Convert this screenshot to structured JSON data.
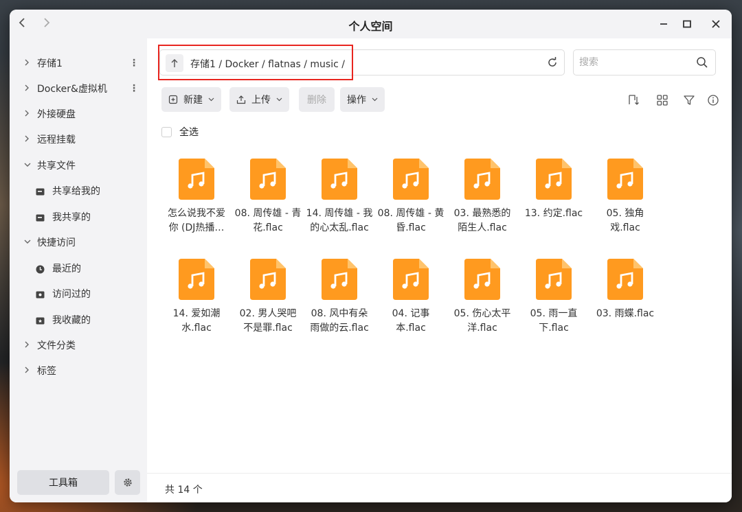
{
  "window": {
    "title": "个人空间",
    "back_glyph": "‹",
    "forward_glyph": "›"
  },
  "sidebar": {
    "items": [
      {
        "label": "存储1",
        "expandable": true,
        "has_more": true
      },
      {
        "label": "Docker&虚拟机",
        "expandable": true,
        "has_more": true
      },
      {
        "label": "外接硬盘",
        "expandable": true
      },
      {
        "label": "远程挂载",
        "expandable": true
      },
      {
        "label": "共享文件",
        "expanded": true
      },
      {
        "label": "共享给我的",
        "icon": "share-in-icon"
      },
      {
        "label": "我共享的",
        "icon": "share-out-icon"
      },
      {
        "label": "快捷访问",
        "expanded": true
      },
      {
        "label": "最近的",
        "icon": "clock-icon"
      },
      {
        "label": "访问过的",
        "icon": "visited-icon"
      },
      {
        "label": "我收藏的",
        "icon": "favorite-icon"
      },
      {
        "label": "文件分类",
        "expandable": true
      },
      {
        "label": "标签",
        "expandable": true
      }
    ],
    "toolbox_label": "工具箱"
  },
  "path": {
    "text": "存储1 / Docker / flatnas / music /"
  },
  "search": {
    "placeholder": "搜索"
  },
  "toolbar": {
    "new_label": "新建",
    "upload_label": "上传",
    "delete_label": "删除",
    "actions_label": "操作"
  },
  "select_all_label": "全选",
  "files": [
    {
      "name": "怎么说我不爱你 (DJ热播…"
    },
    {
      "name": "08. 周传雄 - 青花.flac"
    },
    {
      "name": "14. 周传雄 - 我的心太乱.flac"
    },
    {
      "name": "08. 周传雄 - 黄昏.flac"
    },
    {
      "name": "03. 最熟悉的陌生人.flac"
    },
    {
      "name": "13. 约定.flac"
    },
    {
      "name": "05. 独角戏.flac"
    },
    {
      "name": "14. 爱如潮水.flac"
    },
    {
      "name": "02. 男人哭吧不是罪.flac"
    },
    {
      "name": "08. 风中有朵雨做的云.flac"
    },
    {
      "name": "04. 记事本.flac"
    },
    {
      "name": "05. 伤心太平洋.flac"
    },
    {
      "name": "05. 雨一直下.flac"
    },
    {
      "name": "03. 雨蝶.flac"
    }
  ],
  "file_lines": [
    [
      "怎么说我不爱",
      "你 (DJ热播…"
    ],
    [
      "08. 周传雄 - 青",
      "花.flac"
    ],
    [
      "14. 周传雄 - 我",
      "的心太乱.flac"
    ],
    [
      "08. 周传雄 - 黄",
      "昏.flac"
    ],
    [
      "03. 最熟悉的",
      "陌生人.flac"
    ],
    [
      "13. 约定.flac"
    ],
    [
      "05. 独角",
      "戏.flac"
    ],
    [
      "14. 爱如潮",
      "水.flac"
    ],
    [
      "02. 男人哭吧",
      "不是罪.flac"
    ],
    [
      "08. 风中有朵",
      "雨做的云.flac"
    ],
    [
      "04. 记事",
      "本.flac"
    ],
    [
      "05. 伤心太平",
      "洋.flac"
    ],
    [
      "05. 雨一直",
      "下.flac"
    ],
    [
      "03. 雨蝶.flac"
    ]
  ],
  "footer": {
    "count_text": "共 14 个"
  },
  "colors": {
    "file_icon": "#ff9a1f",
    "file_icon_fold": "#ffc36b",
    "highlight_border": "#e8251f",
    "sidebar_bg": "#f3f3f5"
  }
}
